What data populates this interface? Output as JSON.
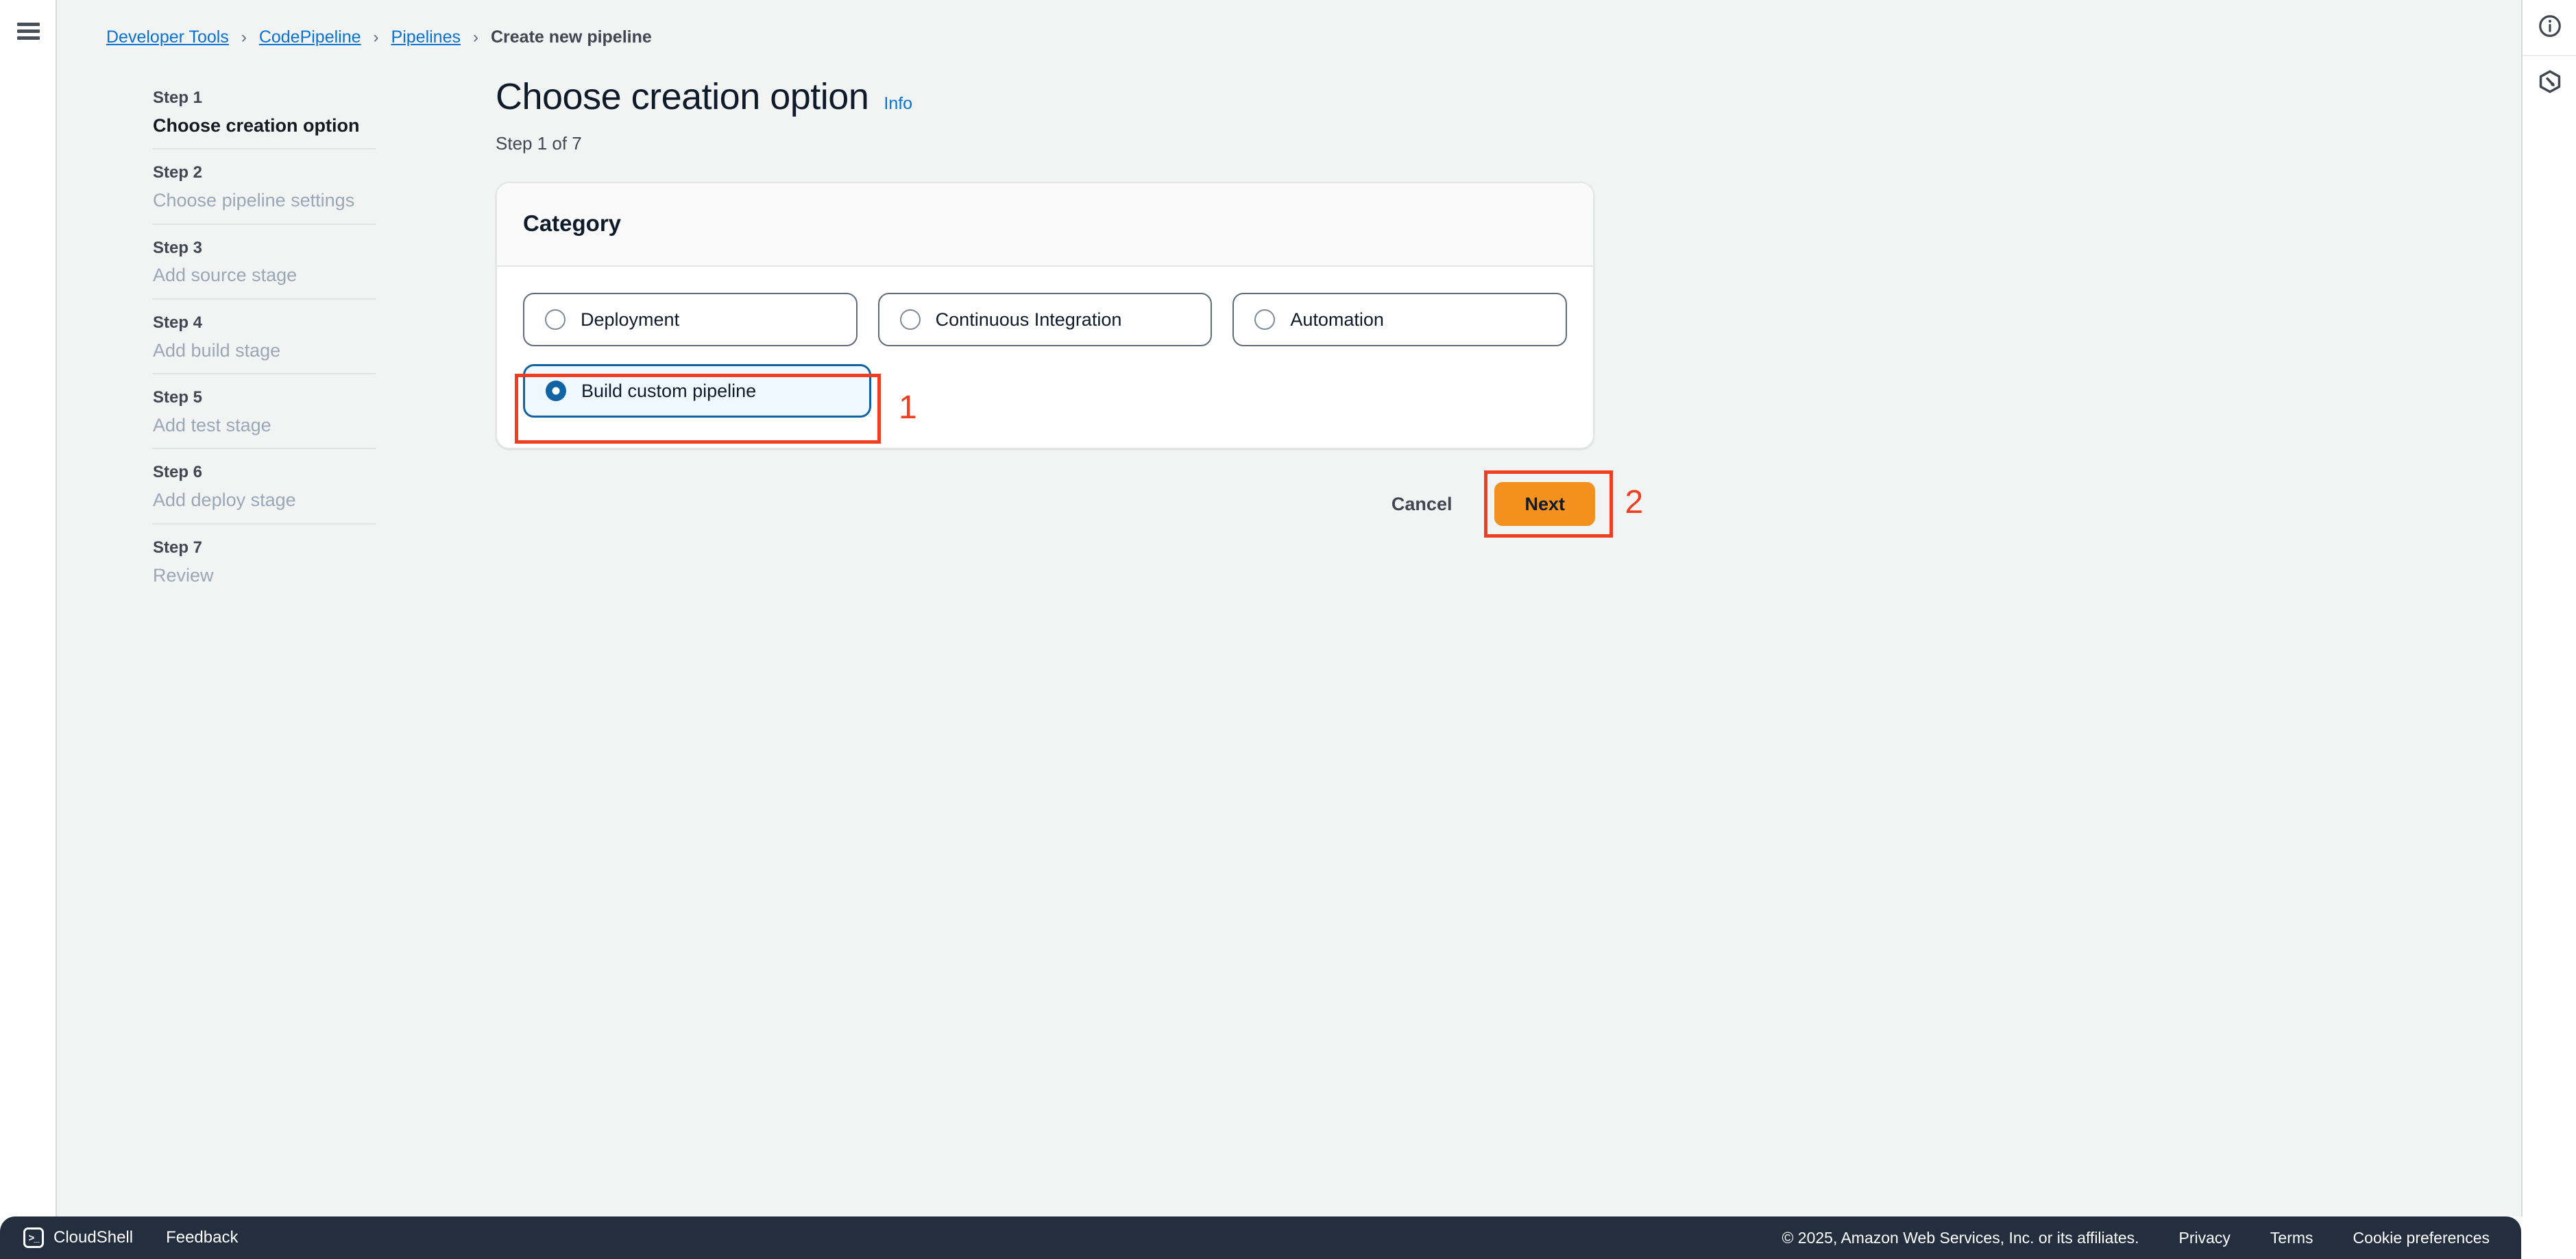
{
  "left_rail": {
    "menu_icon": "hamburger-menu-icon"
  },
  "right_rail": {
    "items": [
      {
        "icon": "info-circle-icon"
      },
      {
        "icon": "hexagon-codecatalyst-icon"
      }
    ]
  },
  "breadcrumb": {
    "items": [
      {
        "label": "Developer Tools",
        "link": true
      },
      {
        "label": "CodePipeline",
        "link": true
      },
      {
        "label": "Pipelines",
        "link": true
      },
      {
        "label": "Create new pipeline",
        "link": false
      }
    ],
    "separator": "›"
  },
  "wizard": {
    "steps": [
      {
        "number": "Step 1",
        "label": "Choose creation option",
        "active": true
      },
      {
        "number": "Step 2",
        "label": "Choose pipeline settings",
        "active": false
      },
      {
        "number": "Step 3",
        "label": "Add source stage",
        "active": false
      },
      {
        "number": "Step 4",
        "label": "Add build stage",
        "active": false
      },
      {
        "number": "Step 5",
        "label": "Add test stage",
        "active": false
      },
      {
        "number": "Step 6",
        "label": "Add deploy stage",
        "active": false
      },
      {
        "number": "Step 7",
        "label": "Review",
        "active": false
      }
    ]
  },
  "page": {
    "title": "Choose creation option",
    "info_label": "Info",
    "subtitle": "Step 1 of 7"
  },
  "category_card": {
    "heading": "Category",
    "options": [
      {
        "label": "Deployment",
        "selected": false
      },
      {
        "label": "Continuous Integration",
        "selected": false
      },
      {
        "label": "Automation",
        "selected": false
      },
      {
        "label": "Build custom pipeline",
        "selected": true
      }
    ]
  },
  "actions": {
    "cancel_label": "Cancel",
    "next_label": "Next"
  },
  "annotations": [
    {
      "number": "1",
      "target": "build-custom-pipeline-tile"
    },
    {
      "number": "2",
      "target": "next-button"
    }
  ],
  "footer": {
    "cloudshell_label": "CloudShell",
    "cloudshell_glyph": ">_",
    "feedback_label": "Feedback",
    "copyright": "© 2025, Amazon Web Services, Inc. or its affiliates.",
    "links": [
      {
        "label": "Privacy"
      },
      {
        "label": "Terms"
      },
      {
        "label": "Cookie preferences"
      }
    ]
  },
  "colors": {
    "accent_link": "#0972d3",
    "selected_border": "#1263a3",
    "selected_fill": "#f0f8ff",
    "next_button": "#f2911d",
    "annotation_red": "#f03e21",
    "footer_bg": "#232f3e",
    "page_bg": "#f2f3f3"
  }
}
